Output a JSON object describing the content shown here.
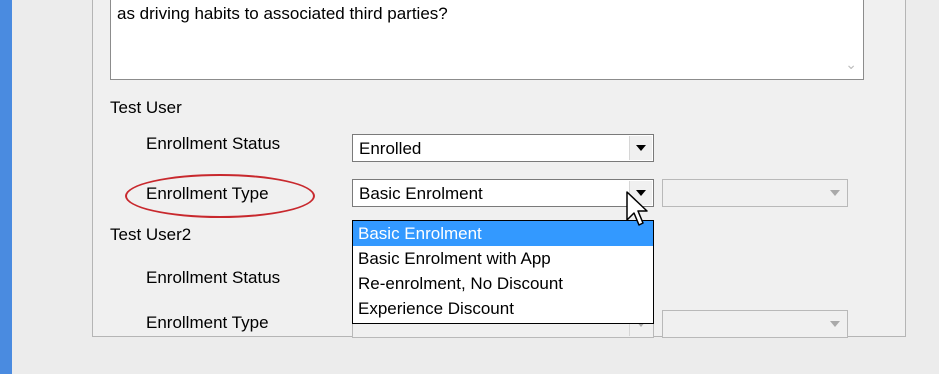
{
  "memo": {
    "text": "as driving habits to associated third parties?",
    "scroll_arrow": "chevron-down-icon"
  },
  "users": [
    {
      "name": "Test User",
      "status_label": "Enrollment Status",
      "status_value": "Enrolled",
      "type_label": "Enrollment Type",
      "type_value": "Basic Enrolment"
    },
    {
      "name": "Test User2",
      "status_label": "Enrollment Status",
      "status_value": "",
      "type_label": "Enrollment Type",
      "type_value": ""
    }
  ],
  "dropdown": {
    "options": [
      "Basic Enrolment",
      "Basic Enrolment with App",
      "Re-enrolment, No Discount",
      "Experience Discount"
    ],
    "selected_index": 0
  },
  "colors": {
    "highlight_ellipse": "#c8282d",
    "selection": "#3399ff",
    "window_accent": "#4a8be0"
  },
  "icons": {
    "dropdown_arrow": "triangle-down-icon",
    "cursor": "mouse-pointer-icon"
  }
}
